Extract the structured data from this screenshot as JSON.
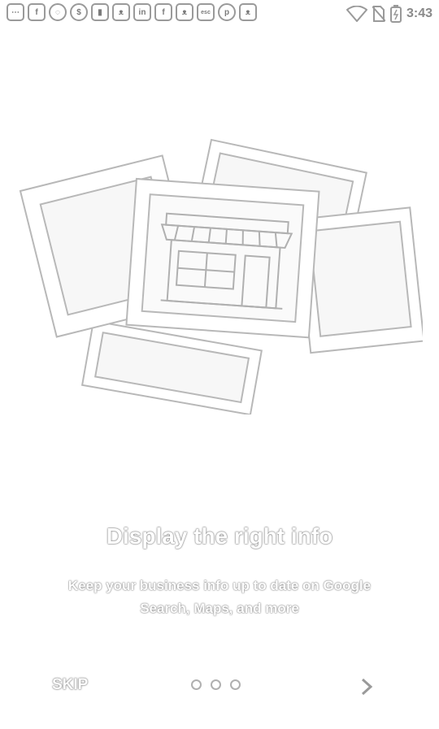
{
  "status_bar": {
    "time": "3:43",
    "notification_icons": [
      {
        "name": "more-icon",
        "glyph": "···"
      },
      {
        "name": "facebook-icon",
        "glyph": "f"
      },
      {
        "name": "whatsapp-icon",
        "glyph": "◌"
      },
      {
        "name": "money-bag-icon",
        "glyph": "$"
      },
      {
        "name": "sim-icon",
        "glyph": "▮"
      },
      {
        "name": "cat-app-icon",
        "glyph": "ᵔᴥᵔ"
      },
      {
        "name": "linkedin-icon",
        "glyph": "in"
      },
      {
        "name": "facebook-icon",
        "glyph": "f"
      },
      {
        "name": "cat-app-icon",
        "glyph": "ᵔᴥᵔ"
      },
      {
        "name": "esc-icon",
        "glyph": "esc"
      },
      {
        "name": "pinterest-icon",
        "glyph": "p"
      },
      {
        "name": "cat-app-icon",
        "glyph": "ᵔᴥᵔ"
      }
    ]
  },
  "onboarding": {
    "title": "Display the right info",
    "subtitle": "Keep your business info up to date on Google Search, Maps, and more",
    "page_count": 3,
    "current_page": 1
  },
  "nav": {
    "skip_label": "SKIP"
  }
}
